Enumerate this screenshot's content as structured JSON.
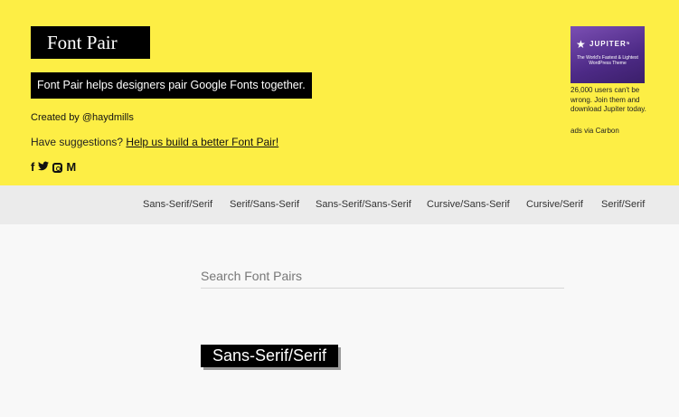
{
  "header": {
    "logo": "Font Pair",
    "tagline": "Font Pair helps designers pair Google Fonts together.",
    "created_by": "Created by @haydmills",
    "suggestions_prefix": "Have suggestions?",
    "suggestions_link": "Help us build a better Font Pair!",
    "social": {
      "facebook": "f",
      "twitter": "🐦",
      "medium": "M"
    }
  },
  "ad": {
    "brand": "JUPITER⁵",
    "subtitle": "The World's Fastest & Lightest WordPress Theme",
    "text": "26,000 users can't be wrong. Join them and download Jupiter today.",
    "via": "ads via Carbon"
  },
  "nav": {
    "items": [
      "Sans-Serif/Serif",
      "Serif/Sans-Serif",
      "Sans-Serif/Sans-Serif",
      "Cursive/Sans-Serif",
      "Cursive/Serif",
      "Serif/Serif"
    ]
  },
  "search": {
    "placeholder": "Search Font Pairs"
  },
  "main": {
    "section_label": "Sans-Serif/Serif"
  },
  "colors": {
    "header_bg": "#fdee45",
    "nav_bg": "#ebebeb",
    "page_bg": "#f8f8f8",
    "label_bg": "#000000"
  }
}
